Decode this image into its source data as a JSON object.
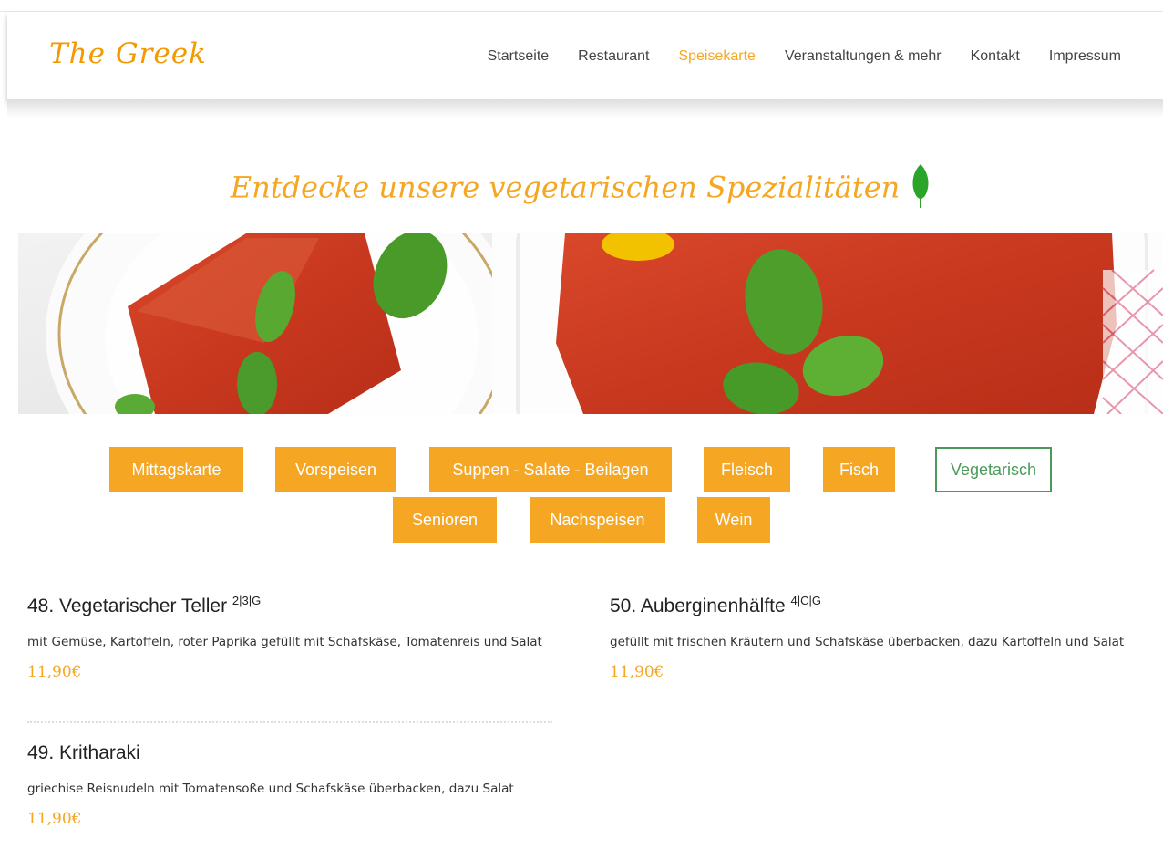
{
  "brand": {
    "logo": "The Greek",
    "accent": "#f5a623",
    "green": "#4a9a5a"
  },
  "nav": {
    "items": [
      {
        "label": "Startseite"
      },
      {
        "label": "Restaurant"
      },
      {
        "label": "Speisekarte",
        "active": true
      },
      {
        "label": "Veranstaltungen & mehr"
      },
      {
        "label": "Kontakt"
      },
      {
        "label": "Impressum"
      }
    ]
  },
  "hero": {
    "tagline": "Entdecke unsere vegetarischen Spezialitäten",
    "icon": "leaf-icon"
  },
  "categories": {
    "row1": [
      "Mittagskarte",
      "Vorspeisen",
      "Suppen - Salate - Beilagen",
      "Fleisch",
      "Fisch",
      "Vegetarisch"
    ],
    "row2": [
      "Senioren",
      "Nachspeisen",
      "Wein"
    ],
    "selected": "Vegetarisch"
  },
  "dishes": [
    {
      "title": "48. Vegetarischer Teller",
      "sup": "2|3|G",
      "desc": "mit Gemüse, Kartoffeln, roter Paprika gefüllt mit Schafskäse, Tomatenreis und Salat",
      "price": "11,90€"
    },
    {
      "title": "49. Kritharaki",
      "sup": "",
      "desc": "griechise Reisnudeln mit Tomatensoße und Schafskäse überbacken, dazu Salat",
      "price": "11,90€"
    },
    {
      "title": "50. Auberginenhälfte",
      "sup": "4|C|G",
      "desc": "gefüllt mit frischen Kräutern und Schafskäse überbacken, dazu Kartoffeln und Salat",
      "price": "11,90€"
    }
  ]
}
